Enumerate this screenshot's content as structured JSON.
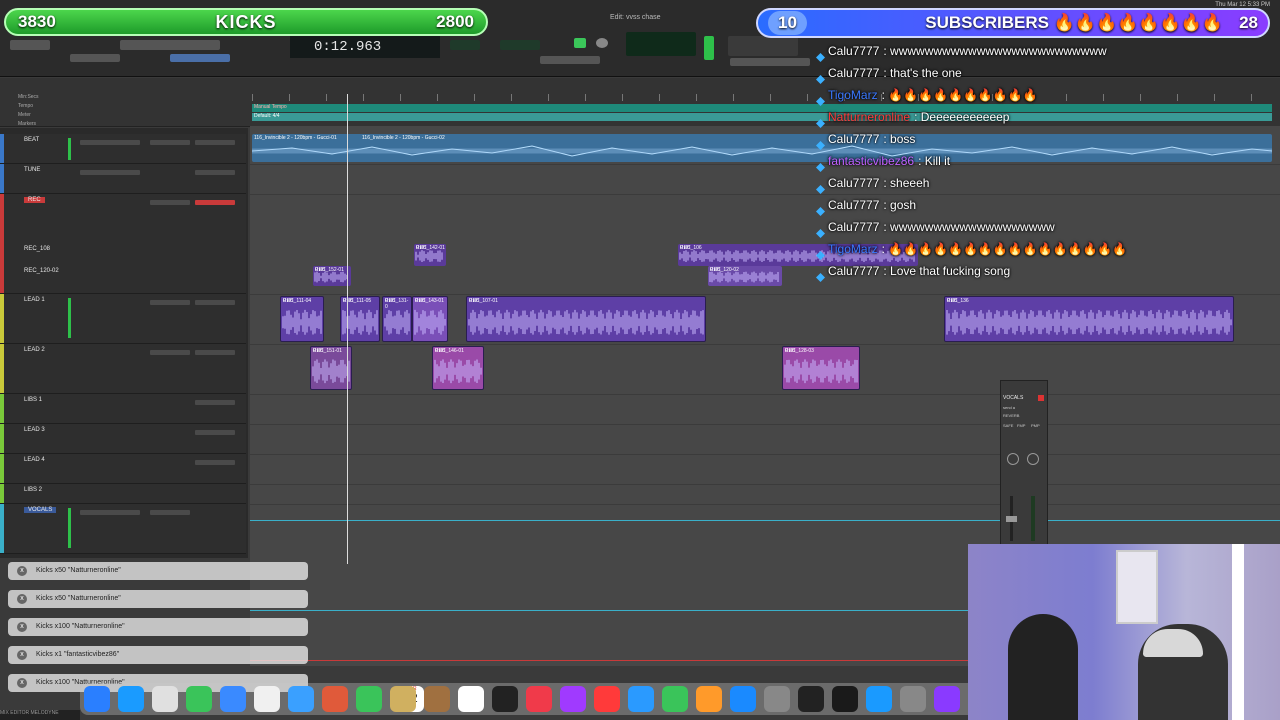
{
  "overlay": {
    "kicks_left": "3830",
    "kicks_title": "KICKS",
    "kicks_right": "2800",
    "subs_left": "10",
    "subs_title": "SUBSCRIBERS 🔥🔥🔥🔥🔥🔥🔥🔥",
    "subs_right": "28"
  },
  "daw": {
    "window_title": "Edit: vvss chase",
    "counter": "0:12.963",
    "menu_date": "Thu Mar 12 5:33 PM"
  },
  "ruler_labels": [
    "Min:Secs",
    "Tempo",
    "Meter",
    "Markers"
  ],
  "ruler_markers": [
    "Default: 4/4",
    "Manual Tempo"
  ],
  "tracks": [
    {
      "name": "BEAT",
      "color": "#3a78c9"
    },
    {
      "name": "TUNE",
      "color": "#3a78c9"
    },
    {
      "name": "REC",
      "color": "#c93a3a"
    },
    {
      "name": "REC_108",
      "color": "#8a4cc9"
    },
    {
      "name": "REC_120-02",
      "color": "#8a4cc9"
    },
    {
      "name": "LEAD 1",
      "color": "#c9c93a"
    },
    {
      "name": "LEAD 2",
      "color": "#c9c93a"
    },
    {
      "name": "LIBS 1",
      "color": "#7ac93a"
    },
    {
      "name": "LEAD 3",
      "color": "#7ac93a"
    },
    {
      "name": "LEAD 4",
      "color": "#7ac93a"
    },
    {
      "name": "LIBS 2",
      "color": "#7ac93a"
    },
    {
      "name": "VOCALS",
      "color": "#3ab0c9"
    }
  ],
  "clips": {
    "beat_a": "116_Invincible 2 - 120bpm - Gucci-01",
    "beat_b": "116_Invincible 2 - 120bpm - Gucci-02",
    "rec_142": "REC_142-01",
    "rec_152": "REC_152-01",
    "rec_106": "REC_106",
    "rec_120": "REC_120-02",
    "lead_111": "REC_111-04",
    "lead_113": "REC_111-05",
    "lead_131": "REC_131-0",
    "lead_143": "REC_143-01",
    "lead_107": "REC_107-01",
    "lead_136": "REC_136",
    "lead2_151": "REC_151-01",
    "lead2_146": "REC_146-01",
    "lead2_128": "REC_128-03",
    "gain": "0 dB"
  },
  "chat": [
    {
      "user": "Calu7777",
      "msg": "wwwwwwwwwwwwwwwwwwwwwwwww",
      "color": "#ffffff"
    },
    {
      "user": "Calu7777",
      "msg": "that's the one",
      "color": "#ffffff"
    },
    {
      "user": "TigoMarz",
      "msg": "🔥🔥🔥🔥🔥🔥🔥🔥🔥🔥",
      "color": "#3a78ff"
    },
    {
      "user": "Natturneronline",
      "msg": "Deeeeeeeeeeep",
      "color": "#ff3a3a"
    },
    {
      "user": "Calu7777",
      "msg": "boss",
      "color": "#ffffff"
    },
    {
      "user": "fantasticvibez86",
      "msg": "Kill it",
      "color": "#c060ff"
    },
    {
      "user": "Calu7777",
      "msg": "sheeeh",
      "color": "#ffffff"
    },
    {
      "user": "Calu7777",
      "msg": "gosh",
      "color": "#ffffff"
    },
    {
      "user": "Calu7777",
      "msg": "wwwwwwwwwwwwwwwwwww",
      "color": "#ffffff"
    },
    {
      "user": "TigoMarz",
      "msg": "🔥🔥🔥🔥🔥🔥🔥🔥🔥🔥🔥🔥🔥🔥🔥🔥",
      "color": "#3a78ff"
    },
    {
      "user": "Calu7777",
      "msg": "Love that fucking song",
      "color": "#ffffff"
    }
  ],
  "kicks_list": [
    "Kicks x50 \"Natturneronline\"",
    "Kicks x50 \"Natturneronline\"",
    "Kicks x100 \"Natturneronline\"",
    "Kicks x1 \"fantasticvibez86\"",
    "Kicks x100 \"Natturneronline\""
  ],
  "mixer": {
    "title": "VOCALS",
    "insert": "send a",
    "reverb": "REVERB",
    "buttons": [
      "SAFE",
      "FMP",
      "PMP"
    ]
  },
  "dock": {
    "calendar_month": "MAR",
    "calendar_day": "12"
  },
  "status": "MIX  EDITOR   MELODYNE"
}
